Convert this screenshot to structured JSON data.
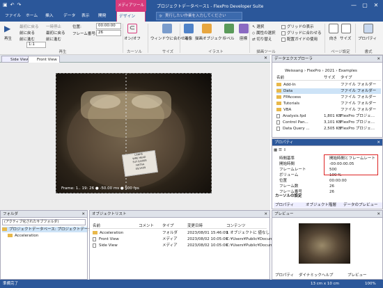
{
  "titlebar": {
    "title": "プロジェクトデータベース1 - FlexPro Developer Suite",
    "context_tab": "メディアツール",
    "qat_icons": [
      "save-icon",
      "undo-icon",
      "redo-icon"
    ]
  },
  "tabs": [
    "ファイル",
    "ホーム",
    "挿入",
    "データ",
    "表示",
    "開発",
    "デザイン"
  ],
  "search": {
    "placeholder": "実行したい作業を入力してください"
  },
  "ribbon": {
    "play": "再生",
    "first_frame": "最初に戻る",
    "prev_frame": "前に進む",
    "prev_frame2": "前に戻る",
    "last_frame": "最初に戻る",
    "pause": "一時停止",
    "next_frame": "前に進む",
    "speed": "1:1",
    "position_label": "位置:",
    "position_value": "00:00:00",
    "frame_label": "フレーム番号:",
    "frame_value": "26",
    "group_play": "再生",
    "onoff": "オン/オフ",
    "group_cursor": "カーソル",
    "fit_window": "ウィンドウに合わせる",
    "group_size": "サイズ",
    "insert_image": "画像",
    "drawing_objects": "描画オブジェクト",
    "label": "ラベル",
    "coords": "座標",
    "group_illust": "イラスト",
    "select": "選択",
    "select_attr": "属性の選択",
    "toggle": "切り替え",
    "group_draw": "描画ツール",
    "grid_show": "グリッドの表示",
    "snap_grid": "グリッドに合わせる",
    "guide_use": "配置ガイドの使用",
    "group_page": "ページ設定",
    "orientation": "向き",
    "size": "サイズ",
    "group_format": "書式",
    "properties": "プロパティ"
  },
  "doctabs": [
    "Side View",
    "Front View"
  ],
  "view": {
    "overlay": "Frame: 1.. 19: 26 ● -50.00 ms ● 500 fps",
    "card_lines": [
      "LSNHS",
      "WRE HEAD",
      "FUT 8/2008",
      "NHTSA",
      "05/1409"
    ]
  },
  "folder_panel": {
    "title": "フォルダ",
    "filter": "(アクティブ化されたサブフォルダ)",
    "root": "プロジェクトデータベース: プロジェクトデータベース1",
    "child": "Acceleration"
  },
  "object_list": {
    "title": "オブジェクトリスト",
    "columns": [
      "名前",
      "コメント",
      "タイプ",
      "変更日時",
      "コンテンツ"
    ],
    "rows": [
      {
        "name": "Acceleration",
        "comment": "",
        "type": "フォルダ",
        "date": "2023/08/01 15:46:09",
        "content": "1 オブジェクトに 値なし"
      },
      {
        "name": "Front View",
        "comment": "",
        "type": "メディア",
        "date": "2023/08/02 10:05:00",
        "content": "C:¥Users¥Public¥Document"
      },
      {
        "name": "Side View",
        "comment": "",
        "type": "メディア",
        "date": "2023/08/02 10:05:00",
        "content": "C:¥Users¥Public¥Document"
      }
    ]
  },
  "explorer": {
    "title": "データエクスプローラ",
    "path": [
      "Weissang",
      "FlexPro",
      "2021",
      "Examples"
    ],
    "columns": [
      "名前",
      "サイズ",
      "タイプ"
    ],
    "rows": [
      {
        "name": "Add-In",
        "size": "",
        "type": "ファイル フォルダー",
        "kind": "folder"
      },
      {
        "name": "Data",
        "size": "",
        "type": "ファイル フォルダー",
        "kind": "folder"
      },
      {
        "name": "FPAccess",
        "size": "",
        "type": "ファイル フォルダー",
        "kind": "folder"
      },
      {
        "name": "Tutorials",
        "size": "",
        "type": "ファイル フォルダー",
        "kind": "folder"
      },
      {
        "name": "VBA",
        "size": "",
        "type": "ファイル フォルダー",
        "kind": "folder"
      },
      {
        "name": "Analysis.fpd",
        "size": "1,801 KB",
        "type": "FlexPro プロジェ...",
        "kind": "file"
      },
      {
        "name": "Control Pan...",
        "size": "3,101 KB",
        "type": "FlexPro プロジェ...",
        "kind": "file"
      },
      {
        "name": "Data Query ...",
        "size": "2,505 KB",
        "type": "FlexPro プロジェ...",
        "kind": "file"
      }
    ]
  },
  "properties": {
    "title": "プロパティ",
    "rows": [
      {
        "k": "時間基準",
        "v": "開始時間とフレームレート"
      },
      {
        "k": "開始時間",
        "v": "-00:00:00.05"
      },
      {
        "k": "フレームレート",
        "v": "500"
      },
      {
        "k": "ボリューム",
        "v": "100 %"
      },
      {
        "k": "位置",
        "v": "00:00:00"
      },
      {
        "k": "フレーム数",
        "v": "26"
      },
      {
        "k": "フレーム番号",
        "v": "26"
      }
    ],
    "section": "カーソルの設定",
    "tabs": [
      "プロパティ",
      "オブジェクト階層",
      "データのプレビュー"
    ]
  },
  "preview": {
    "title": "プレビュー",
    "tabs": [
      "プロパティ",
      "ダイナミックヘルプ",
      "プレビュー"
    ]
  },
  "status": {
    "left": "準備完了",
    "size": "13 cm x 10 cm",
    "zoom": "100%"
  },
  "colors": {
    "accent": "#2b579a",
    "media_tab": "#d83b7c",
    "highlight": "#d22222"
  }
}
